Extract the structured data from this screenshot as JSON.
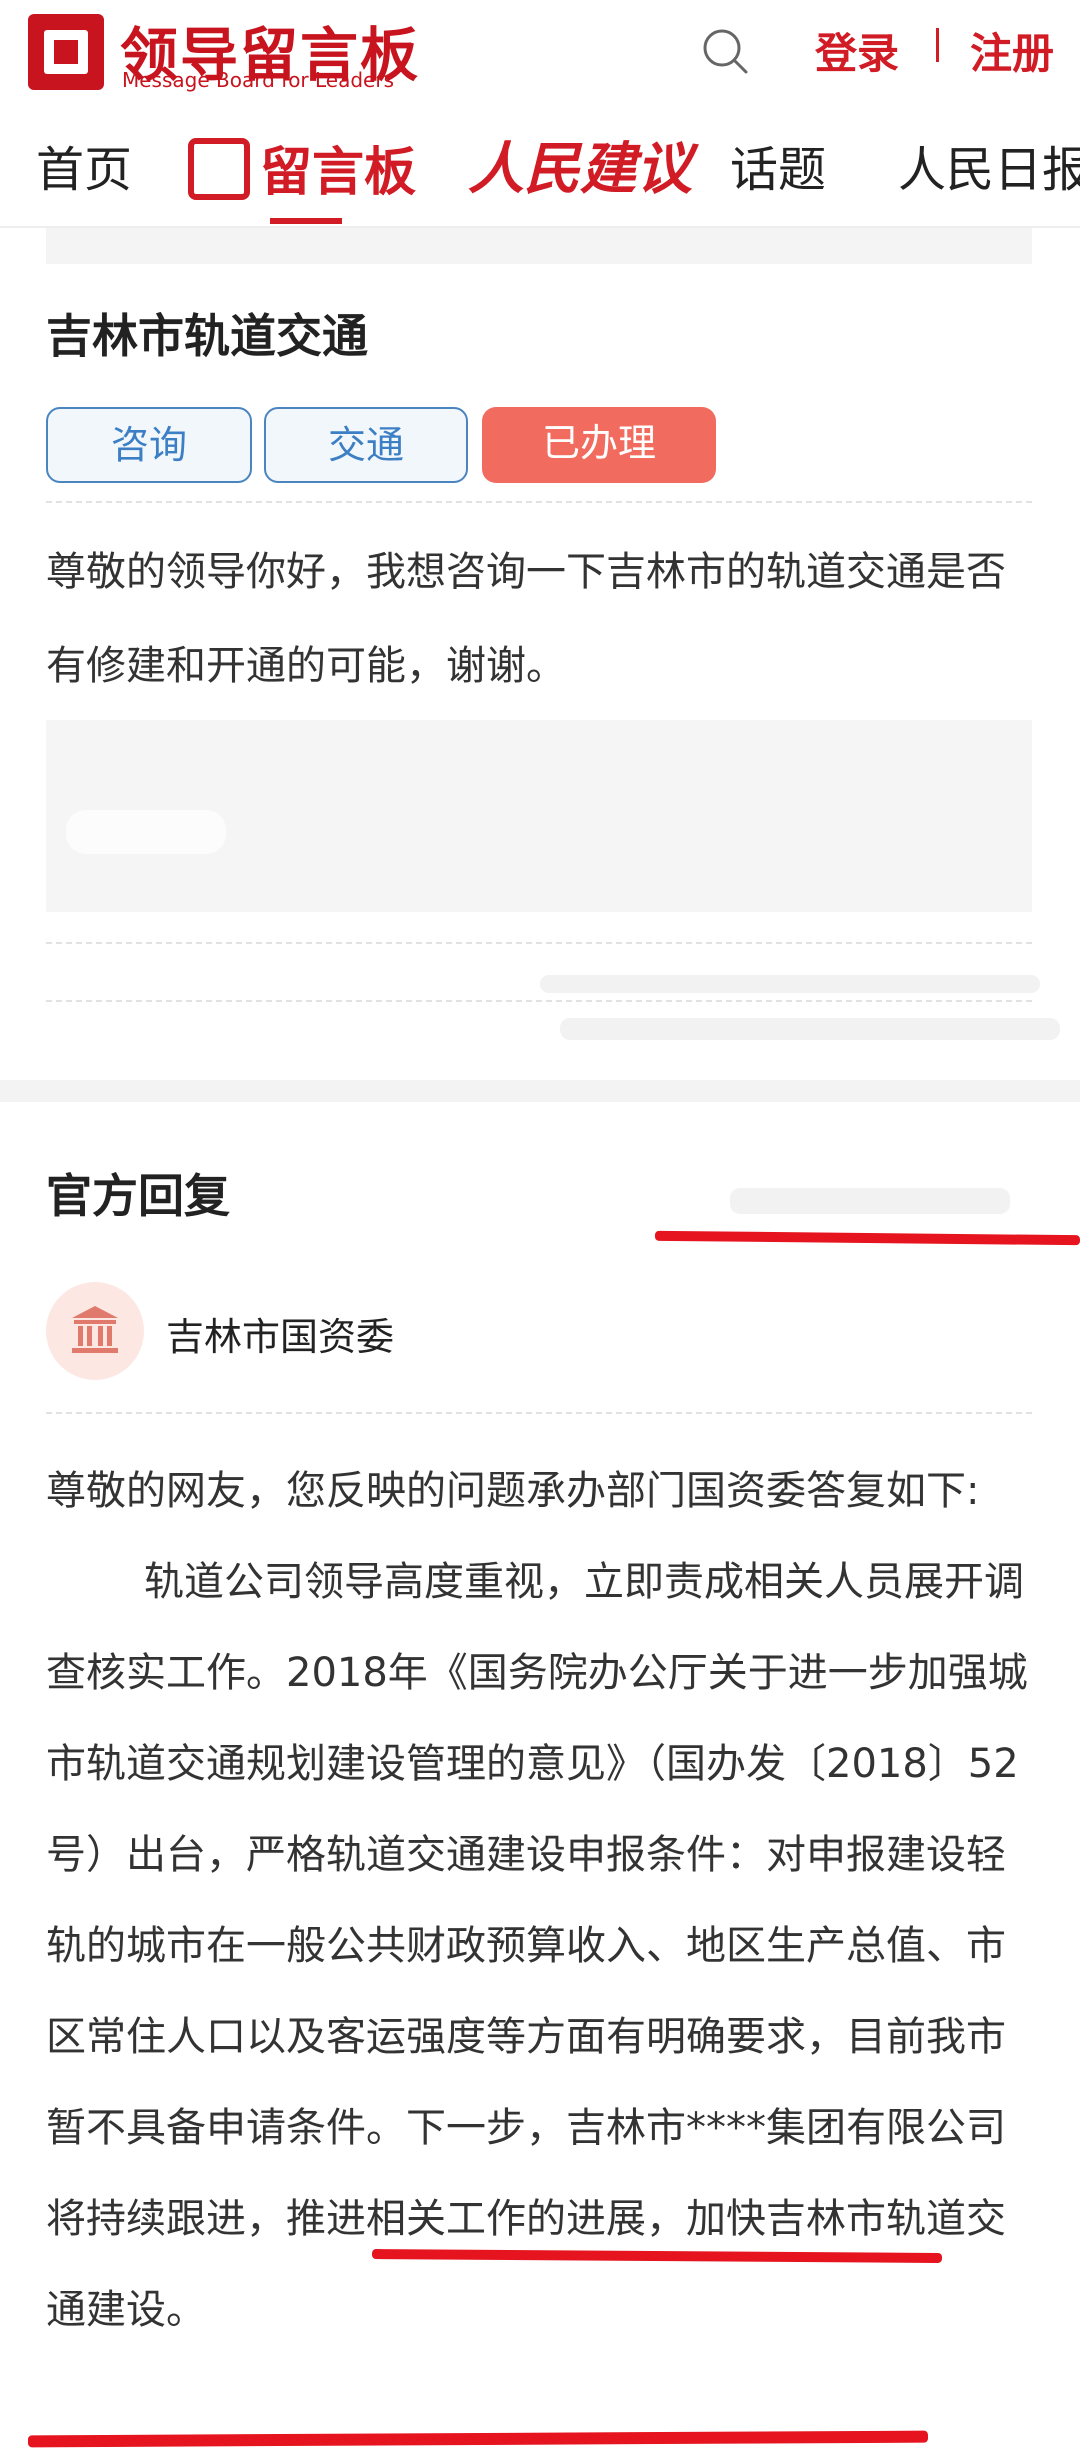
{
  "header": {
    "logo_title": "领导留言板",
    "logo_subtitle": "Message Board for Leaders",
    "login_label": "登录",
    "register_label": "注册",
    "brand_color": "#d11b25"
  },
  "nav": {
    "home": "首页",
    "board": "留言板",
    "people_suggestion": "人民建议",
    "topics": "话题",
    "people_daily": "人民日报"
  },
  "message": {
    "title": "吉林市轨道交通",
    "tags": [
      "咨询",
      "交通",
      "已办理"
    ],
    "body": "尊敬的领导你好，我想咨询一下吉林市的轨道交通是否有修建和开通的可能，谢谢。"
  },
  "reply": {
    "section_title": "官方回复",
    "org_name": "吉林市国资委",
    "org_icon": "government-building-icon",
    "para1": "尊敬的网友，您反映的问题承办部门国资委答复如下:",
    "para2_a": "轨道公司领导高度重视，立即责成相关人员展开调查核实工作。2018年《国务院办公厅关于进一步加强城市轨道交通规划建设管理的意见》（国办发〔2018〕52号）出台，严格轨道交通建设申报条件：对申报建设轻轨的城市在一般公共财政预算收入、地区生产总值、市区常住人口以及客运强度等方面有明确要求，",
    "para2_b": "目前我市暂不具备申请条件",
    "para2_c": "。下一步，吉林市****集团有限公司将持续跟进，推进相关工作的进展，加快吉林市轨道交通建设。"
  },
  "colors": {
    "tag_blue": "#3d7fc4",
    "tag_done": "#f26b5f",
    "annotation_red": "#e5141f"
  }
}
